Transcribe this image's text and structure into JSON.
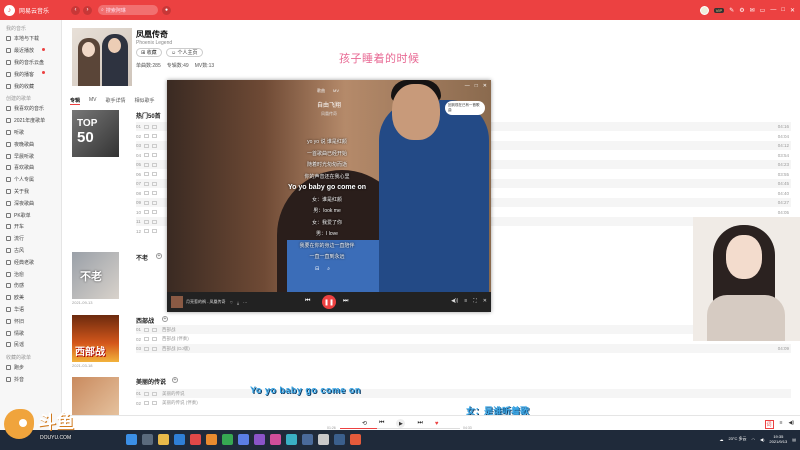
{
  "app": {
    "title": "网易云音乐"
  },
  "search": {
    "placeholder": "搜索阿琳"
  },
  "sidebar": {
    "heads": [
      "我的音乐",
      "创建的歌单",
      "收藏的歌单"
    ],
    "items": [
      "本地与下载",
      "最近播放",
      "我的音乐云盘",
      "我的播客",
      "我的收藏",
      "我喜欢的音乐",
      "2021年度歌单",
      "听歌",
      "夜晚歌曲",
      "早晨听歌",
      "喜欢歌曲",
      "个人专属",
      "关于我",
      "深夜歌曲",
      "PK歌单",
      "开车",
      "流行",
      "古风",
      "经典老歌",
      "治愈",
      "伤感",
      "欧美",
      "华语",
      "怀旧",
      "情歌",
      "民谣",
      "跑步",
      "抖音"
    ]
  },
  "artist": {
    "name": "凤凰传奇",
    "english": "Phoenix Legend",
    "follow_label": "收藏",
    "homepage_label": "个人主页",
    "stats": [
      "单曲数:285",
      "专辑数:49",
      "MV数:13"
    ]
  },
  "watermark": "孩子睡着的时候",
  "tabs": [
    "专辑",
    "MV",
    "歌手详情",
    "相似歌手"
  ],
  "top50": {
    "line1": "TOP",
    "line2": "50",
    "section": "热门50首"
  },
  "songs_top": [
    {
      "name": "",
      "dur": "04:16"
    },
    {
      "name": "",
      "dur": "04:04"
    },
    {
      "name": "",
      "dur": "04:12"
    },
    {
      "name": "",
      "dur": "03:54"
    },
    {
      "name": "",
      "dur": "04:23"
    },
    {
      "name": "",
      "dur": "03:55"
    },
    {
      "name": "",
      "dur": "04:45"
    },
    {
      "name": "",
      "dur": "04:40"
    },
    {
      "name": "",
      "dur": "04:27"
    },
    {
      "name": "",
      "dur": "04:05"
    },
    {
      "name": "",
      "dur": "04:18"
    },
    {
      "name": "",
      "dur": "04:13"
    }
  ],
  "albums": [
    {
      "title": "不老",
      "date": "2021-09-13",
      "cover_text": "不老"
    },
    {
      "title": "西部战",
      "date": "2021-03-18",
      "cover_text": "西部战"
    },
    {
      "title": "美丽的传说",
      "date": "",
      "cover_text": ""
    }
  ],
  "songs_album2": [
    {
      "name": "西部战",
      "dur": ""
    },
    {
      "name": "西部战 (伴奏)",
      "dur": ""
    },
    {
      "name": "西部战 (DJ版)",
      "dur": "04:09"
    }
  ],
  "songs_album3": [
    {
      "name": "美丽的传说",
      "dur": ""
    },
    {
      "name": "美丽的传说 (伴奏)",
      "dur": ""
    }
  ],
  "player": {
    "tabs": [
      "歌曲",
      "MV"
    ],
    "title": "自由飞翔",
    "subtitle": "凤凰传奇",
    "note": "回到现在已有一首歌曲",
    "lyrics": [
      "yo yo 说 谁是红颜",
      "一首歌曲已经开始",
      "随着时光匆匆而逝",
      "你的声音还在我心里",
      "Yo yo baby go come on",
      "女：谁是红颜",
      "男：look me",
      "女：我爱了你",
      "男：I love",
      "我要在你的身边一直陪伴",
      "一直一直到永远"
    ],
    "highlight_index": 4,
    "now_playing": "月亮惹的祸 - 凤凰传奇",
    "controls": [
      "♡",
      "⤓",
      "⋯"
    ],
    "right_icons": [
      "◀))",
      "≡",
      "⛶",
      "✕"
    ]
  },
  "captions": {
    "en": "Yo yo baby go come on",
    "cn": "女：是谁听着歌"
  },
  "bottom": {
    "time_cur": "01:26",
    "time_total": "04:33",
    "progress": 0.31,
    "lyric_btn": "词"
  },
  "taskbar": {
    "weather": "23°C 多云",
    "time": "19:35",
    "date": "2021/9/13"
  },
  "douyu": {
    "brand": "斗鱼",
    "url": "DOUYU.COM"
  },
  "colors": {
    "accent": "#ec4141",
    "caption": "#3aa6e6"
  }
}
